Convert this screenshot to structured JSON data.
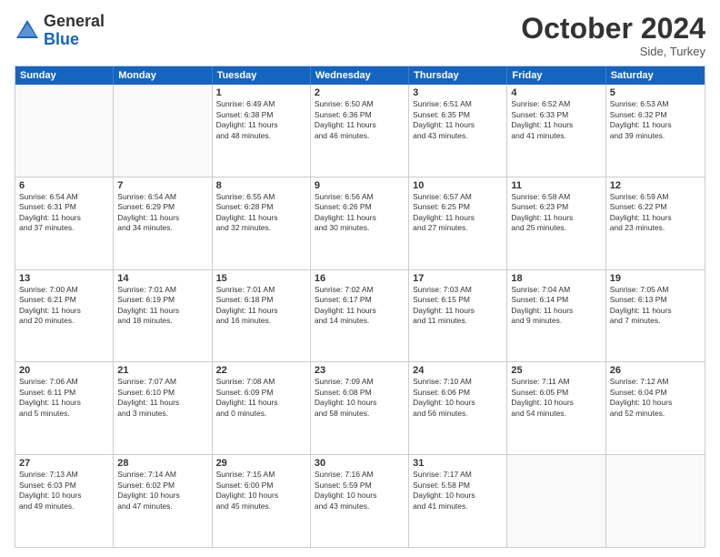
{
  "header": {
    "logo_general": "General",
    "logo_blue": "Blue",
    "month": "October 2024",
    "location": "Side, Turkey"
  },
  "days_of_week": [
    "Sunday",
    "Monday",
    "Tuesday",
    "Wednesday",
    "Thursday",
    "Friday",
    "Saturday"
  ],
  "weeks": [
    [
      {
        "day": "",
        "lines": []
      },
      {
        "day": "",
        "lines": []
      },
      {
        "day": "1",
        "lines": [
          "Sunrise: 6:49 AM",
          "Sunset: 6:38 PM",
          "Daylight: 11 hours",
          "and 48 minutes."
        ]
      },
      {
        "day": "2",
        "lines": [
          "Sunrise: 6:50 AM",
          "Sunset: 6:36 PM",
          "Daylight: 11 hours",
          "and 46 minutes."
        ]
      },
      {
        "day": "3",
        "lines": [
          "Sunrise: 6:51 AM",
          "Sunset: 6:35 PM",
          "Daylight: 11 hours",
          "and 43 minutes."
        ]
      },
      {
        "day": "4",
        "lines": [
          "Sunrise: 6:52 AM",
          "Sunset: 6:33 PM",
          "Daylight: 11 hours",
          "and 41 minutes."
        ]
      },
      {
        "day": "5",
        "lines": [
          "Sunrise: 6:53 AM",
          "Sunset: 6:32 PM",
          "Daylight: 11 hours",
          "and 39 minutes."
        ]
      }
    ],
    [
      {
        "day": "6",
        "lines": [
          "Sunrise: 6:54 AM",
          "Sunset: 6:31 PM",
          "Daylight: 11 hours",
          "and 37 minutes."
        ]
      },
      {
        "day": "7",
        "lines": [
          "Sunrise: 6:54 AM",
          "Sunset: 6:29 PM",
          "Daylight: 11 hours",
          "and 34 minutes."
        ]
      },
      {
        "day": "8",
        "lines": [
          "Sunrise: 6:55 AM",
          "Sunset: 6:28 PM",
          "Daylight: 11 hours",
          "and 32 minutes."
        ]
      },
      {
        "day": "9",
        "lines": [
          "Sunrise: 6:56 AM",
          "Sunset: 6:26 PM",
          "Daylight: 11 hours",
          "and 30 minutes."
        ]
      },
      {
        "day": "10",
        "lines": [
          "Sunrise: 6:57 AM",
          "Sunset: 6:25 PM",
          "Daylight: 11 hours",
          "and 27 minutes."
        ]
      },
      {
        "day": "11",
        "lines": [
          "Sunrise: 6:58 AM",
          "Sunset: 6:23 PM",
          "Daylight: 11 hours",
          "and 25 minutes."
        ]
      },
      {
        "day": "12",
        "lines": [
          "Sunrise: 6:59 AM",
          "Sunset: 6:22 PM",
          "Daylight: 11 hours",
          "and 23 minutes."
        ]
      }
    ],
    [
      {
        "day": "13",
        "lines": [
          "Sunrise: 7:00 AM",
          "Sunset: 6:21 PM",
          "Daylight: 11 hours",
          "and 20 minutes."
        ]
      },
      {
        "day": "14",
        "lines": [
          "Sunrise: 7:01 AM",
          "Sunset: 6:19 PM",
          "Daylight: 11 hours",
          "and 18 minutes."
        ]
      },
      {
        "day": "15",
        "lines": [
          "Sunrise: 7:01 AM",
          "Sunset: 6:18 PM",
          "Daylight: 11 hours",
          "and 16 minutes."
        ]
      },
      {
        "day": "16",
        "lines": [
          "Sunrise: 7:02 AM",
          "Sunset: 6:17 PM",
          "Daylight: 11 hours",
          "and 14 minutes."
        ]
      },
      {
        "day": "17",
        "lines": [
          "Sunrise: 7:03 AM",
          "Sunset: 6:15 PM",
          "Daylight: 11 hours",
          "and 11 minutes."
        ]
      },
      {
        "day": "18",
        "lines": [
          "Sunrise: 7:04 AM",
          "Sunset: 6:14 PM",
          "Daylight: 11 hours",
          "and 9 minutes."
        ]
      },
      {
        "day": "19",
        "lines": [
          "Sunrise: 7:05 AM",
          "Sunset: 6:13 PM",
          "Daylight: 11 hours",
          "and 7 minutes."
        ]
      }
    ],
    [
      {
        "day": "20",
        "lines": [
          "Sunrise: 7:06 AM",
          "Sunset: 6:11 PM",
          "Daylight: 11 hours",
          "and 5 minutes."
        ]
      },
      {
        "day": "21",
        "lines": [
          "Sunrise: 7:07 AM",
          "Sunset: 6:10 PM",
          "Daylight: 11 hours",
          "and 3 minutes."
        ]
      },
      {
        "day": "22",
        "lines": [
          "Sunrise: 7:08 AM",
          "Sunset: 6:09 PM",
          "Daylight: 11 hours",
          "and 0 minutes."
        ]
      },
      {
        "day": "23",
        "lines": [
          "Sunrise: 7:09 AM",
          "Sunset: 6:08 PM",
          "Daylight: 10 hours",
          "and 58 minutes."
        ]
      },
      {
        "day": "24",
        "lines": [
          "Sunrise: 7:10 AM",
          "Sunset: 6:06 PM",
          "Daylight: 10 hours",
          "and 56 minutes."
        ]
      },
      {
        "day": "25",
        "lines": [
          "Sunrise: 7:11 AM",
          "Sunset: 6:05 PM",
          "Daylight: 10 hours",
          "and 54 minutes."
        ]
      },
      {
        "day": "26",
        "lines": [
          "Sunrise: 7:12 AM",
          "Sunset: 6:04 PM",
          "Daylight: 10 hours",
          "and 52 minutes."
        ]
      }
    ],
    [
      {
        "day": "27",
        "lines": [
          "Sunrise: 7:13 AM",
          "Sunset: 6:03 PM",
          "Daylight: 10 hours",
          "and 49 minutes."
        ]
      },
      {
        "day": "28",
        "lines": [
          "Sunrise: 7:14 AM",
          "Sunset: 6:02 PM",
          "Daylight: 10 hours",
          "and 47 minutes."
        ]
      },
      {
        "day": "29",
        "lines": [
          "Sunrise: 7:15 AM",
          "Sunset: 6:00 PM",
          "Daylight: 10 hours",
          "and 45 minutes."
        ]
      },
      {
        "day": "30",
        "lines": [
          "Sunrise: 7:16 AM",
          "Sunset: 5:59 PM",
          "Daylight: 10 hours",
          "and 43 minutes."
        ]
      },
      {
        "day": "31",
        "lines": [
          "Sunrise: 7:17 AM",
          "Sunset: 5:58 PM",
          "Daylight: 10 hours",
          "and 41 minutes."
        ]
      },
      {
        "day": "",
        "lines": []
      },
      {
        "day": "",
        "lines": []
      }
    ]
  ]
}
